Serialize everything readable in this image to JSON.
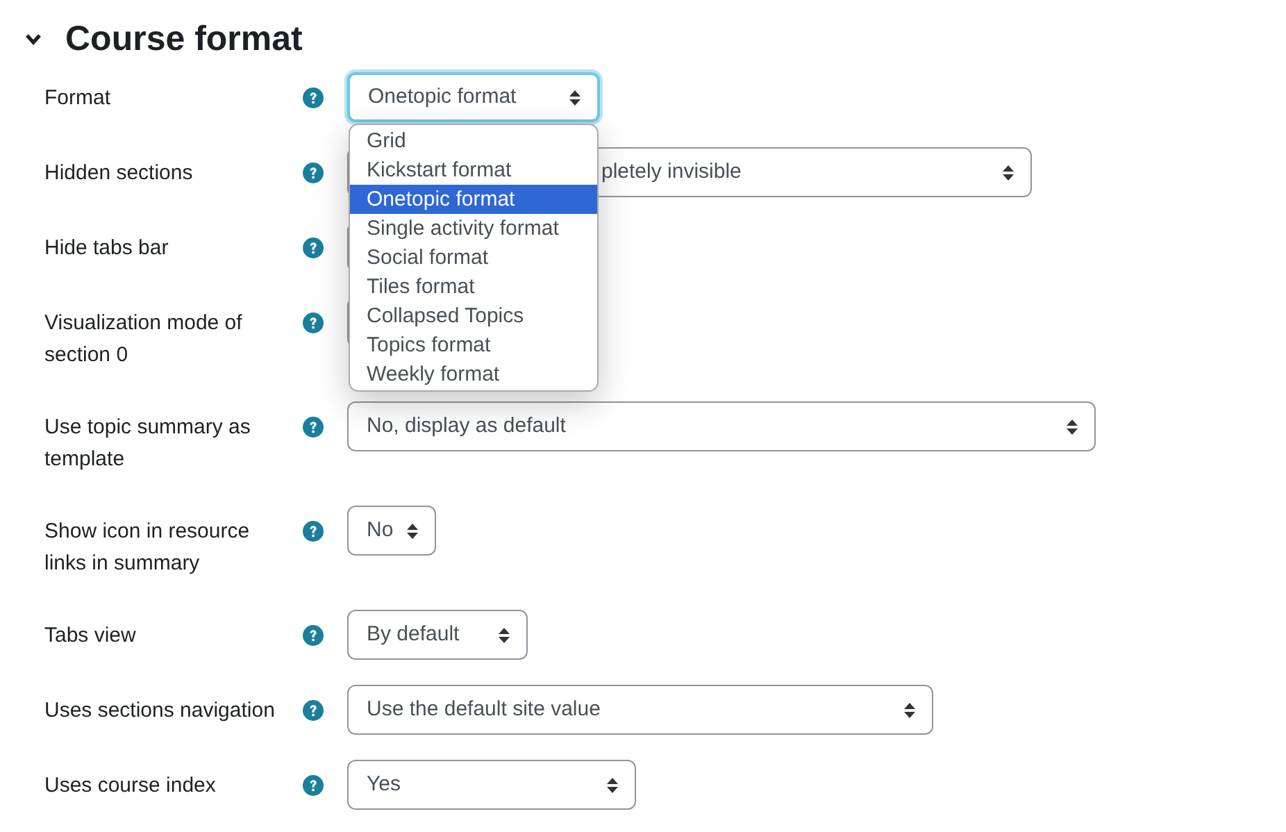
{
  "section": {
    "title": "Course format",
    "expanded": true
  },
  "fields": [
    {
      "label": "Format",
      "value": "Onetopic format",
      "focused": true,
      "dropdown": {
        "options": [
          {
            "label": "Grid",
            "selected": false
          },
          {
            "label": "Kickstart format",
            "selected": false
          },
          {
            "label": "Onetopic format",
            "selected": true
          },
          {
            "label": "Single activity format",
            "selected": false
          },
          {
            "label": "Social format",
            "selected": false
          },
          {
            "label": "Tiles format",
            "selected": false
          },
          {
            "label": "Collapsed Topics",
            "selected": false
          },
          {
            "label": "Topics format",
            "selected": false
          },
          {
            "label": "Weekly format",
            "selected": false
          }
        ]
      }
    },
    {
      "label": "Hidden sections",
      "value": "pletely invisible",
      "focused": false
    },
    {
      "label": "Hide tabs bar",
      "focused": false
    },
    {
      "label": "Visualization mode of section 0",
      "focused": false
    },
    {
      "label": "Use topic summary as template",
      "value": "No, display as default",
      "focused": false
    },
    {
      "label": "Show icon in resource links in summary",
      "value": "No",
      "focused": false
    },
    {
      "label": "Tabs view",
      "value": "By default",
      "focused": false
    },
    {
      "label": "Uses sections navigation",
      "value": "Use the default site value",
      "focused": false
    },
    {
      "label": "Uses course index",
      "value": "Yes",
      "focused": false
    }
  ]
}
